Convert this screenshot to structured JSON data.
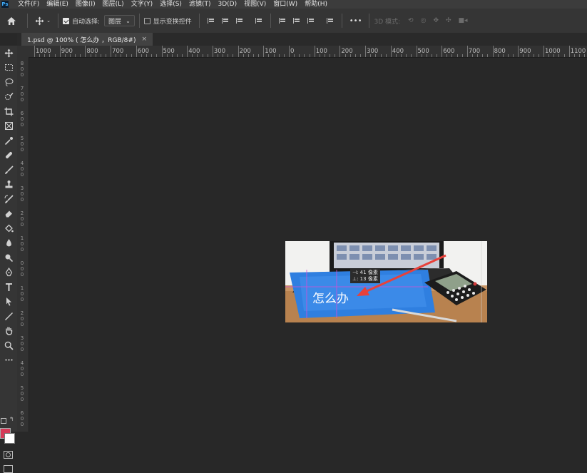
{
  "app": {
    "logo": "Ps"
  },
  "menu": [
    "文件(F)",
    "编辑(E)",
    "图像(I)",
    "图层(L)",
    "文字(Y)",
    "选择(S)",
    "滤镜(T)",
    "3D(D)",
    "视图(V)",
    "窗口(W)",
    "帮助(H)"
  ],
  "options": {
    "auto_select_label": "自动选择:",
    "auto_select_checked": true,
    "layer_select": "图层",
    "show_transform_label": "显示变换控件",
    "show_transform_checked": false,
    "more": "•••",
    "mode_3d": "3D 模式:"
  },
  "document_tab": {
    "title": "1.psd @ 100% ( 怎么办 ，RGB/8#)",
    "close": "×"
  },
  "ruler": {
    "top_labels": [
      "1000",
      "900",
      "800",
      "700",
      "600",
      "500",
      "400",
      "300",
      "200",
      "100",
      "0",
      "100",
      "200",
      "300",
      "400",
      "500",
      "600",
      "700",
      "800",
      "900",
      "1000",
      "1100"
    ],
    "left_labels": [
      "8",
      "7",
      "6",
      "5",
      "4",
      "3",
      "2",
      "1",
      "0",
      "1",
      "2",
      "3",
      "4",
      "5",
      "6"
    ]
  },
  "canvas": {
    "text": "怎么办",
    "measure_h": "⊣: 41 像素",
    "measure_v": "⊥: 13 像素"
  },
  "colors": {
    "foreground": "#d63a58",
    "background": "#ffffff",
    "accent_blue": "#2f7fe0",
    "arrow": "#e8413a"
  },
  "tools": [
    "move-icon",
    "marquee-icon",
    "lasso-icon",
    "quick-select-icon",
    "crop-icon",
    "frame-icon",
    "eyedropper-icon",
    "healing-icon",
    "brush-icon",
    "stamp-icon",
    "history-brush-icon",
    "eraser-icon",
    "paint-bucket-icon",
    "blur-icon",
    "dodge-icon",
    "pen-icon",
    "type-icon",
    "path-select-icon",
    "line-icon",
    "hand-icon",
    "zoom-icon",
    "more-tools-icon"
  ]
}
